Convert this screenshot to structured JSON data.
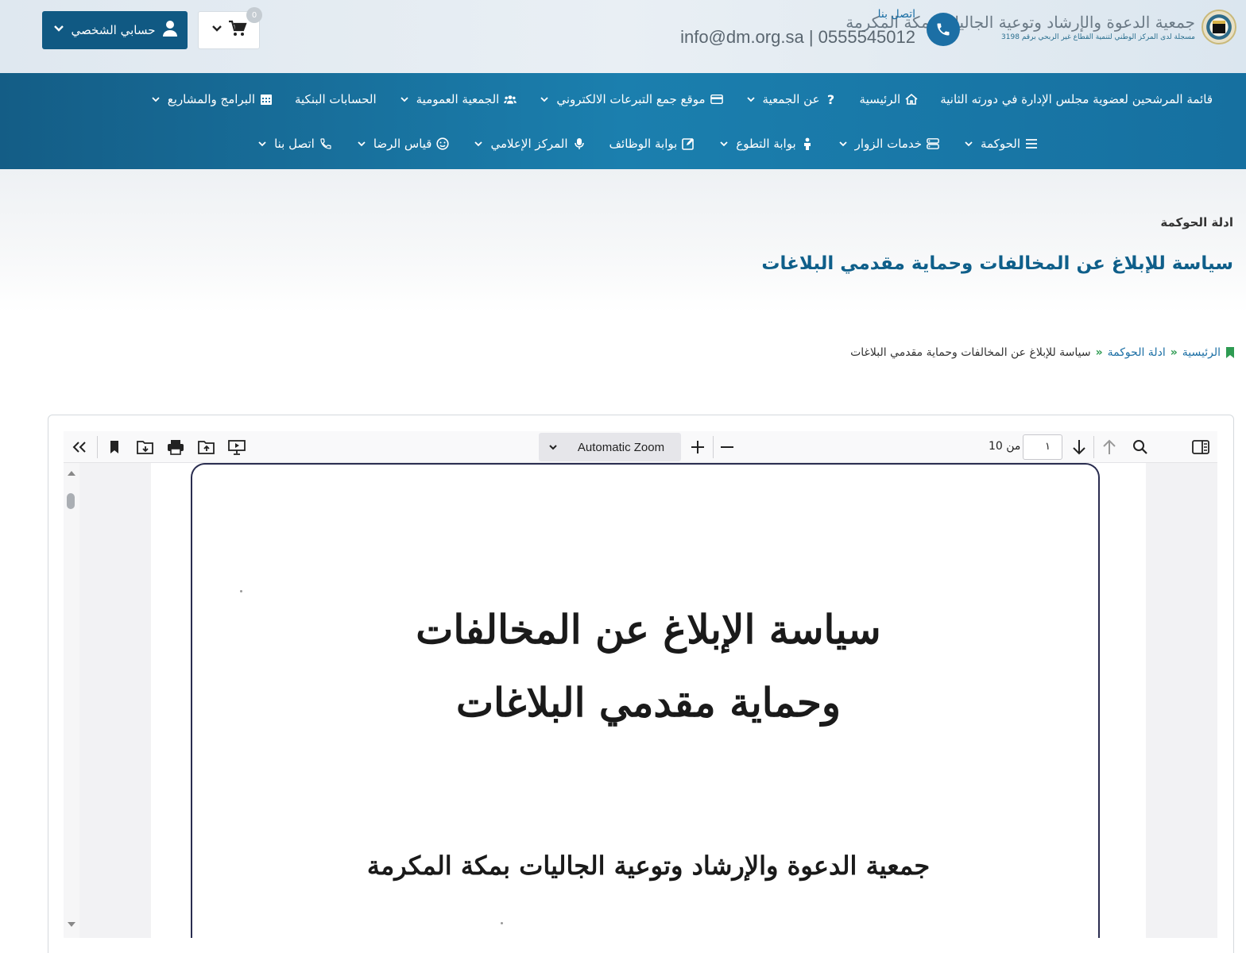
{
  "header": {
    "logo": {
      "title": "جمعية الدعوة والإرشاد وتوعية الجاليات بمكة المكرمة",
      "subtitle": "مسجلة لدى المركز الوطني لتنمية القطاع غير الربحي برقم 3198"
    },
    "contact": {
      "label": "اتصل بنا",
      "line": "info@dm.org.sa | 0555545012"
    },
    "cart": {
      "count": "0"
    },
    "account": {
      "label": "حسابي الشخصي"
    }
  },
  "nav": {
    "row1": [
      {
        "label": "قائمة المرشحين لعضوية مجلس الإدارة في دورته الثانية",
        "icon": "",
        "has_dropdown": false
      },
      {
        "label": "الرئيسية",
        "icon": "home-icon",
        "has_dropdown": false
      },
      {
        "label": "عن الجمعية",
        "icon": "question-icon",
        "has_dropdown": true
      },
      {
        "label": "موقع جمع التبرعات الالكتروني",
        "icon": "credit-card-icon",
        "has_dropdown": true
      },
      {
        "label": "الجمعية العمومية",
        "icon": "users-icon",
        "has_dropdown": true
      },
      {
        "label": "الحسابات البنكية",
        "icon": "",
        "has_dropdown": false
      },
      {
        "label": "البرامج والمشاريع",
        "icon": "calendar-icon",
        "has_dropdown": true
      }
    ],
    "row2": [
      {
        "label": "الحوكمة",
        "icon": "menu-icon",
        "has_dropdown": true
      },
      {
        "label": "خدمات الزوار",
        "icon": "server-icon",
        "has_dropdown": true
      },
      {
        "label": "بوابة التطوع",
        "icon": "person-icon",
        "has_dropdown": true
      },
      {
        "label": "بوابة الوظائف",
        "icon": "edit-icon",
        "has_dropdown": false
      },
      {
        "label": "المركز الإعلامي",
        "icon": "microphone-icon",
        "has_dropdown": true
      },
      {
        "label": "قياس الرضا",
        "icon": "smile-icon",
        "has_dropdown": true
      },
      {
        "label": "اتصل بنا",
        "icon": "phone-icon",
        "has_dropdown": true
      }
    ]
  },
  "hero": {
    "kicker": "ادلة الحوكمة",
    "title": "سياسة للإبلاغ عن المخالفات وحماية مقدمي البلاغات"
  },
  "breadcrumb": {
    "home": "الرئيسية",
    "separator": "»",
    "section": "ادلة الحوكمة",
    "current": "سياسة للإبلاغ عن المخالفات وحماية مقدمي البلاغات"
  },
  "viewer": {
    "zoom_label": "Automatic Zoom",
    "page_input_value": "١",
    "page_count_label": "من 10",
    "document": {
      "title_line1": "سياسة الإبلاغ عن المخالفات",
      "title_line2": "وحماية مقدمي البلاغات",
      "org_name": "جمعية الدعوة والإرشاد وتوعية الجاليات بمكة المكرمة"
    }
  },
  "colors": {
    "primary": "#105983",
    "nav_gradient_mid": "#1b7fae",
    "breadcrumb_sep": "#2e9b52",
    "page_border": "#2a2d50"
  }
}
